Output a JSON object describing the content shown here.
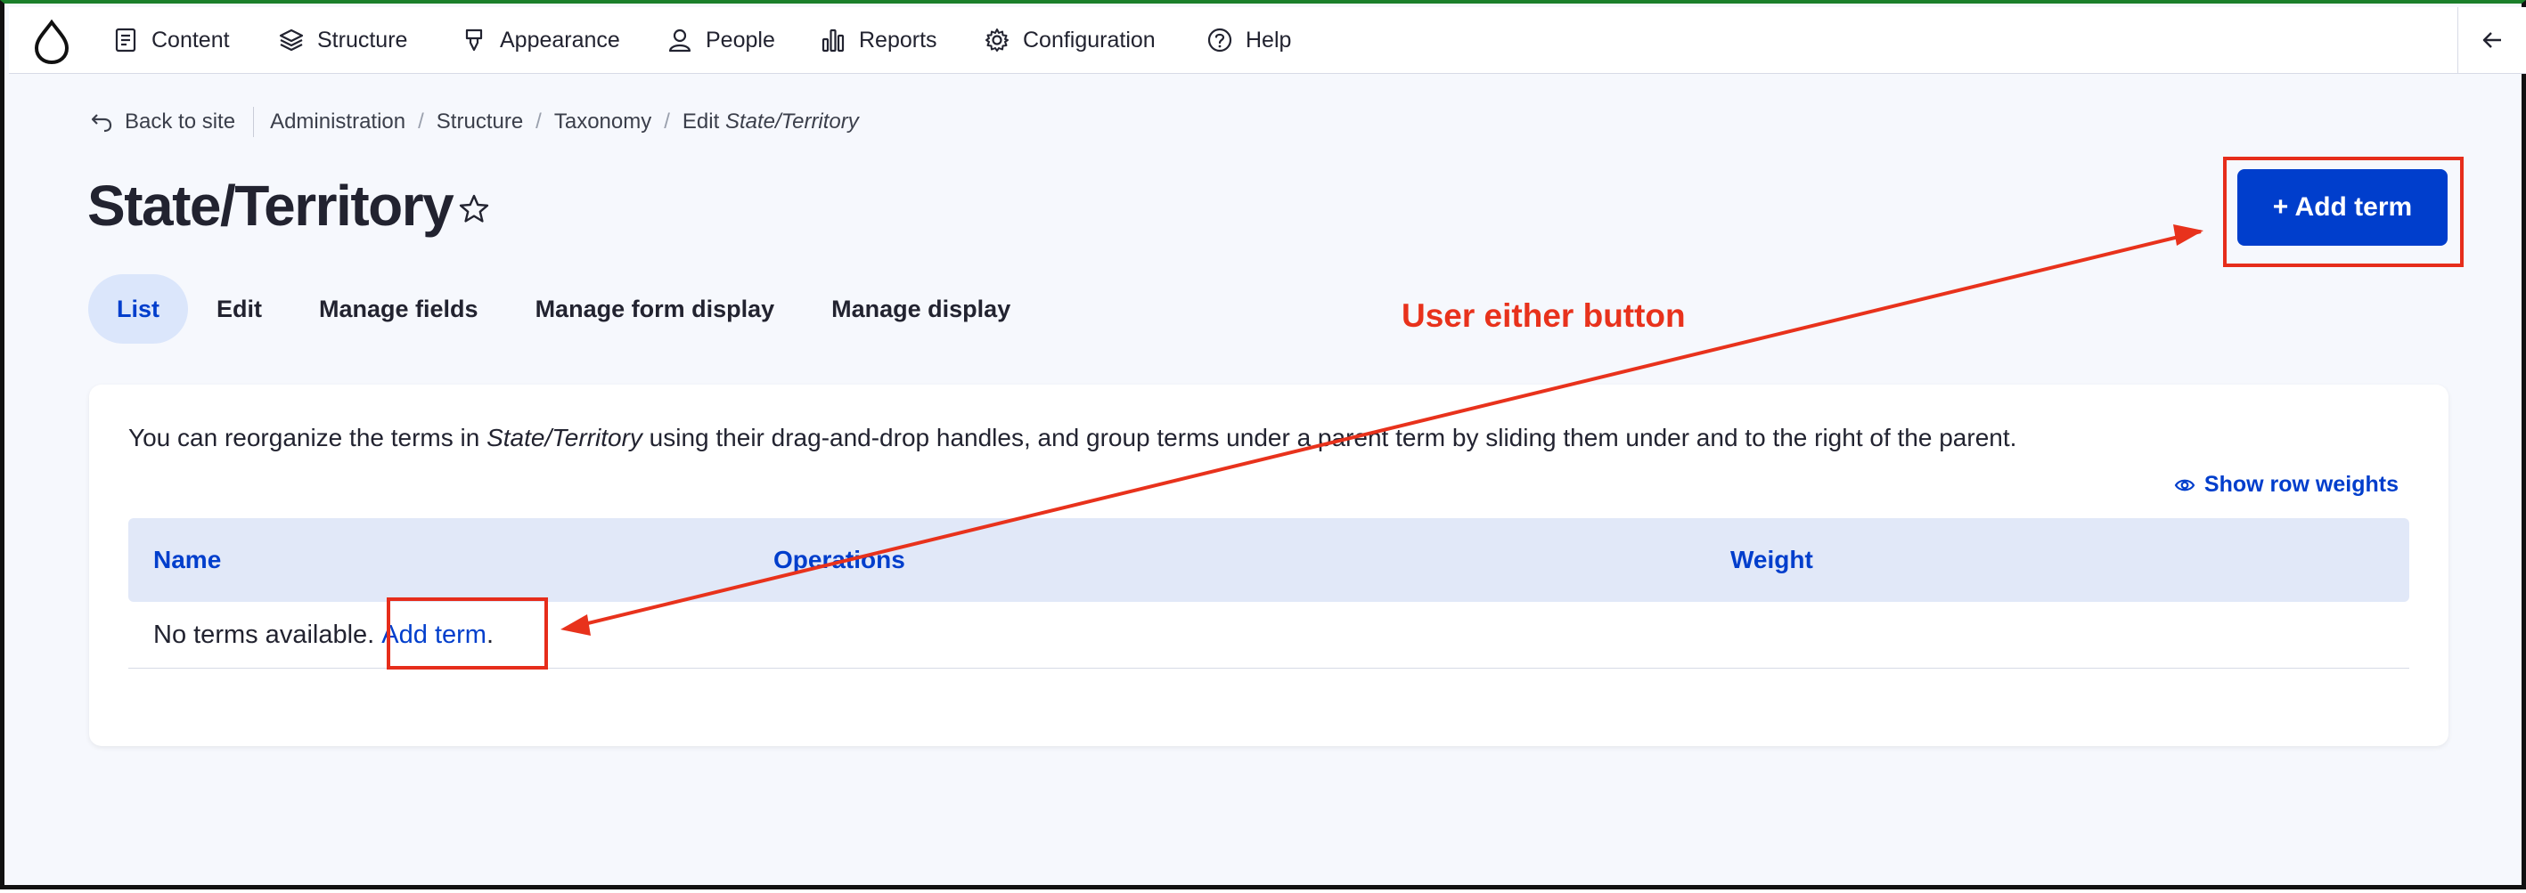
{
  "toolbar": {
    "items": [
      {
        "label": "Content",
        "icon": "document-icon"
      },
      {
        "label": "Structure",
        "icon": "layers-icon"
      },
      {
        "label": "Appearance",
        "icon": "brush-icon"
      },
      {
        "label": "People",
        "icon": "person-icon"
      },
      {
        "label": "Reports",
        "icon": "bar-chart-icon"
      },
      {
        "label": "Configuration",
        "icon": "gear-icon"
      },
      {
        "label": "Help",
        "icon": "help-icon"
      }
    ],
    "logo_icon": "drupal-drop-icon",
    "collapse_icon": "arrow-left-icon"
  },
  "breadcrumb": {
    "back": "Back to site",
    "items": [
      "Administration",
      "Structure",
      "Taxonomy"
    ],
    "edit_prefix": "Edit",
    "edit_name": "State/Territory"
  },
  "page": {
    "title": "State/Territory",
    "add_button": "+ Add term"
  },
  "tabs": [
    "List",
    "Edit",
    "Manage fields",
    "Manage form display",
    "Manage display"
  ],
  "card": {
    "help_before": "You can reorganize the terms in ",
    "help_em": "State/Territory",
    "help_after": " using their drag-and-drop handles, and group terms under a parent term by sliding them under and to the right of the parent.",
    "row_weights": "Show row weights",
    "columns": [
      "Name",
      "Operations",
      "Weight"
    ],
    "empty_text": "No terms available. ",
    "empty_link": "Add term",
    "empty_end": "."
  },
  "annotation": {
    "text": "User either button",
    "color": "#e8321c"
  },
  "colors": {
    "accent": "#003ecc",
    "tab_active_bg": "#dbe6fb",
    "table_header_bg": "#e1e8f8"
  }
}
